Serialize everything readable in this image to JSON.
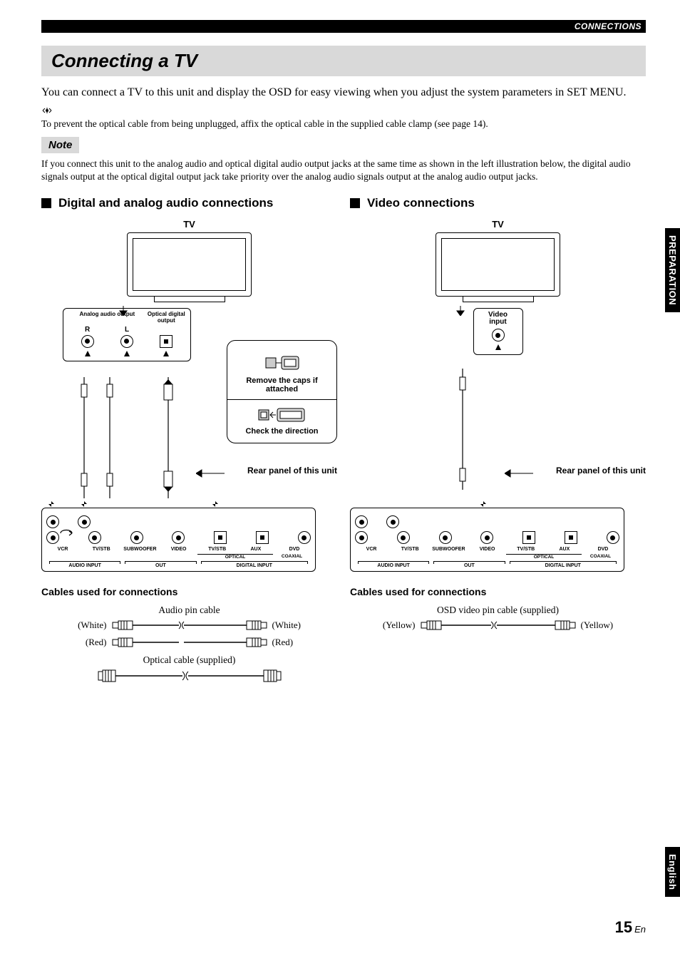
{
  "header": {
    "section": "CONNECTIONS"
  },
  "title": "Connecting a TV",
  "intro": "You can connect a TV to this unit and display the OSD for easy viewing when you adjust the system parameters in SET MENU.",
  "tip": "To prevent the optical cable from being unplugged, affix the optical cable in the supplied cable clamp (see page 14).",
  "note": {
    "label": "Note",
    "text": "If you connect this unit to the analog audio and optical digital audio output jacks at the same time as shown in the left illustration below, the digital audio signals output at the optical digital output jack take priority over the analog audio signals output at the analog audio output jacks."
  },
  "left": {
    "heading": "Digital and analog audio connections",
    "tv_label": "TV",
    "jack": {
      "analog": "Analog audio\noutput",
      "optical": "Optical digital\noutput",
      "r": "R",
      "l": "L"
    },
    "info": {
      "remove": "Remove the caps if attached",
      "check": "Check the direction"
    },
    "rear_label": "Rear panel of this unit",
    "cables": {
      "heading": "Cables used for connections",
      "audio_caption": "Audio pin cable",
      "white": "(White)",
      "red": "(Red)",
      "optical_caption": "Optical cable (supplied)"
    }
  },
  "right": {
    "heading": "Video connections",
    "tv_label": "TV",
    "jack": {
      "video": "Video\ninput"
    },
    "rear_label": "Rear panel of this unit",
    "cables": {
      "heading": "Cables used for connections",
      "caption": "OSD video pin cable (supplied)",
      "yellow": "(Yellow)"
    }
  },
  "rear_panel": {
    "vcr": "VCR",
    "tvstb": "TV/STB",
    "sub": "SUBWOOFER",
    "video": "VIDEO",
    "tvstb_opt": "TV/STB",
    "aux": "AUX",
    "dvd": "DVD",
    "optical": "OPTICAL",
    "coaxial": "COAXIAL",
    "audio_input": "AUDIO INPUT",
    "out": "OUT",
    "digital_input": "DIGITAL INPUT"
  },
  "tabs": {
    "prep": "PREPARATION",
    "eng": "English"
  },
  "page": {
    "num": "15",
    "suffix": "En"
  }
}
